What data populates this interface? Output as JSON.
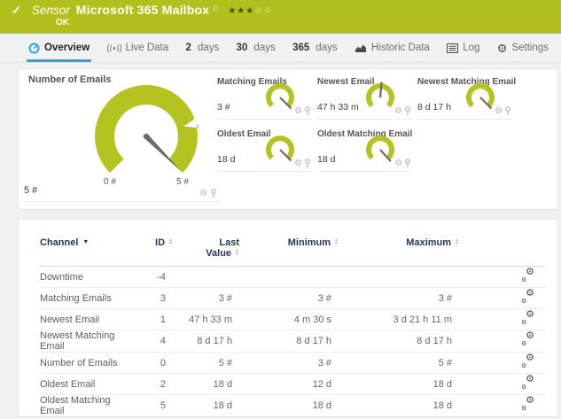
{
  "header": {
    "check_icon": "✓",
    "kind": "Sensor",
    "title": "Microsoft 365 Mailbox",
    "flag_icon": "⚐",
    "stars_filled": "★★★",
    "stars_empty": "☆☆",
    "status": "OK",
    "brand_color": "#b2c01d"
  },
  "tabs": {
    "overview": "Overview",
    "live_data": "Live Data",
    "d2_num": "2",
    "d2_label": "days",
    "d30_num": "30",
    "d30_label": "days",
    "d365_num": "365",
    "d365_label": "days",
    "historic": "Historic Data",
    "log": "Log",
    "settings": "Settings"
  },
  "icons": {
    "gear": "⚙",
    "sort_up": "▲",
    "sort_down": "▼",
    "caret_down": "▼"
  },
  "overview": {
    "main_gauge": {
      "title": "Number of Emails",
      "value": "5 #",
      "scale_min": "0 #",
      "scale_max": "5 #",
      "marker": "x",
      "gauge_color": "#b4c31f",
      "needle_color": "#6b6b6b"
    },
    "mini_gauges": [
      {
        "title": "Matching Emails",
        "value": "3 #"
      },
      {
        "title": "Newest Email",
        "value": "47 h 33 m"
      },
      {
        "title": "Newest Matching Email",
        "value": "8 d 17 h"
      },
      {
        "title": "Oldest Email",
        "value": "18 d"
      },
      {
        "title": "Oldest Matching Email",
        "value": "18 d"
      }
    ]
  },
  "table": {
    "headers": {
      "channel": "Channel",
      "id": "ID",
      "last_line1": "Last",
      "last_line2": "Value",
      "minimum": "Minimum",
      "maximum": "Maximum"
    },
    "rows": [
      {
        "channel": "Downtime",
        "id": "-4",
        "last": "",
        "min": "",
        "max": ""
      },
      {
        "channel": "Matching Emails",
        "id": "3",
        "last": "3 #",
        "min": "3 #",
        "max": "3 #"
      },
      {
        "channel": "Newest Email",
        "id": "1",
        "last": "47 h 33 m",
        "min": "4 m 30 s",
        "max": "3 d 21 h 11 m"
      },
      {
        "channel": "Newest Matching Email",
        "id": "4",
        "last": "8 d 17 h",
        "min": "8 d 17 h",
        "max": "8 d 17 h"
      },
      {
        "channel": "Number of Emails",
        "id": "0",
        "last": "5 #",
        "min": "3 #",
        "max": "5 #"
      },
      {
        "channel": "Oldest Email",
        "id": "2",
        "last": "18 d",
        "min": "12 d",
        "max": "18 d"
      },
      {
        "channel": "Oldest Matching Email",
        "id": "5",
        "last": "18 d",
        "min": "18 d",
        "max": "18 d"
      }
    ]
  }
}
